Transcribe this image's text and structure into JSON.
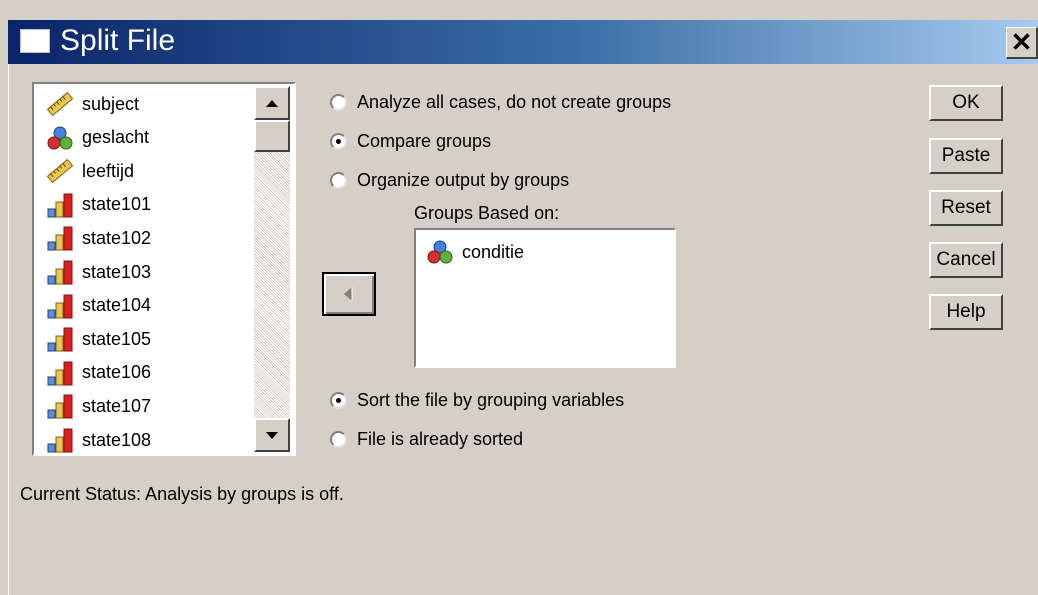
{
  "window": {
    "title": "Split File",
    "close_label": "✕"
  },
  "variables": [
    {
      "name": "subject",
      "type": "scale"
    },
    {
      "name": "geslacht",
      "type": "nominal"
    },
    {
      "name": "leeftijd",
      "type": "scale"
    },
    {
      "name": "state101",
      "type": "ordinal"
    },
    {
      "name": "state102",
      "type": "ordinal"
    },
    {
      "name": "state103",
      "type": "ordinal"
    },
    {
      "name": "state104",
      "type": "ordinal"
    },
    {
      "name": "state105",
      "type": "ordinal"
    },
    {
      "name": "state106",
      "type": "ordinal"
    },
    {
      "name": "state107",
      "type": "ordinal"
    },
    {
      "name": "state108",
      "type": "ordinal"
    }
  ],
  "options": {
    "analyze_all": {
      "label": "Analyze all cases, do not create groups",
      "selected": false
    },
    "compare_groups": {
      "label": "Compare groups",
      "selected": true
    },
    "organize_output": {
      "label": "Organize output by groups",
      "selected": false
    }
  },
  "groups_based_on": {
    "label": "Groups Based on:",
    "items": [
      {
        "name": "conditie",
        "type": "nominal"
      }
    ]
  },
  "sort": {
    "sort_file": {
      "label": "Sort the file by grouping variables",
      "selected": true
    },
    "already_sorted": {
      "label": "File is already sorted",
      "selected": false
    }
  },
  "buttons": {
    "ok": "OK",
    "paste": "Paste",
    "reset": "Reset",
    "cancel": "Cancel",
    "help": "Help"
  },
  "status": "Current Status:  Analysis by groups is off."
}
